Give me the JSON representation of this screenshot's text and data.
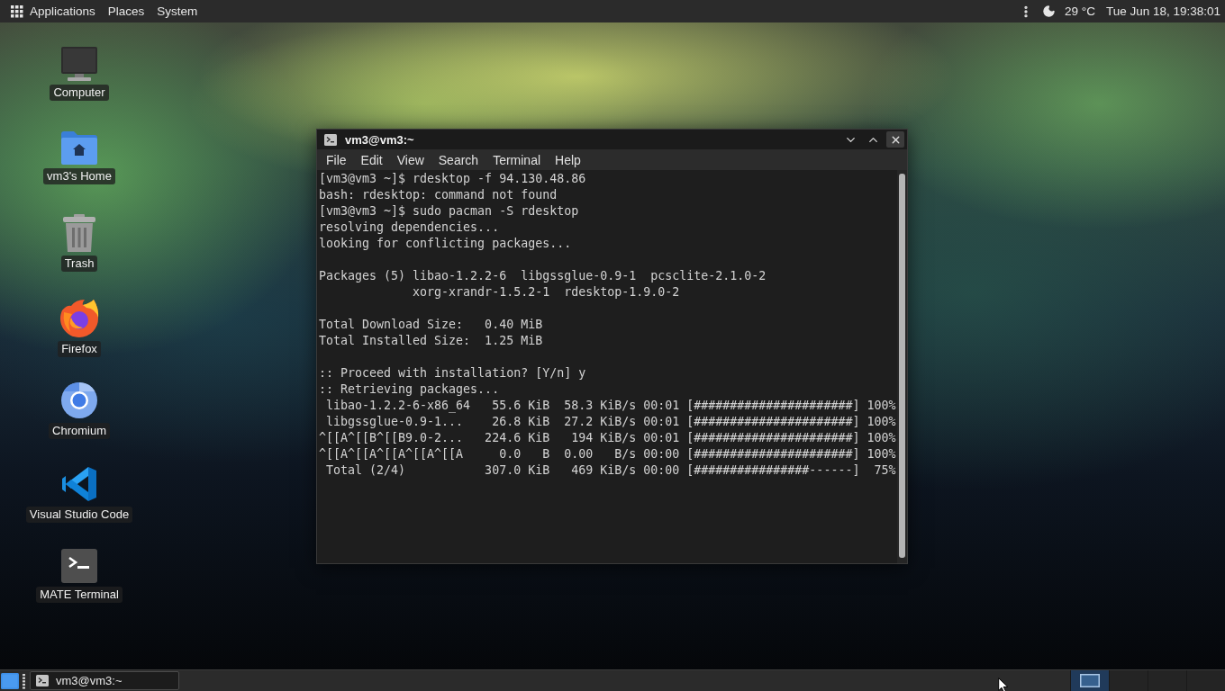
{
  "top_panel": {
    "menus": [
      {
        "label": "Applications"
      },
      {
        "label": "Places"
      },
      {
        "label": "System"
      }
    ],
    "temperature": "29 °C",
    "clock": "Tue Jun 18, 19:38:01"
  },
  "desktop_icons": [
    {
      "label": "Computer",
      "kind": "computer"
    },
    {
      "label": "vm3's Home",
      "kind": "home"
    },
    {
      "label": "Trash",
      "kind": "trash"
    },
    {
      "label": "Firefox",
      "kind": "firefox"
    },
    {
      "label": "Chromium",
      "kind": "chromium"
    },
    {
      "label": "Visual Studio Code",
      "kind": "vscode"
    },
    {
      "label": "MATE Terminal",
      "kind": "terminal"
    }
  ],
  "terminal_window": {
    "title": "vm3@vm3:~",
    "menu": [
      "File",
      "Edit",
      "View",
      "Search",
      "Terminal",
      "Help"
    ],
    "blocks": [
      [
        "[vm3@vm3 ~]$ rdesktop -f 94.130.48.86",
        "bash: rdesktop: command not found",
        "[vm3@vm3 ~]$ sudo pacman -S rdesktop",
        "resolving dependencies...",
        "looking for conflicting packages..."
      ],
      [
        "Packages (5) libao-1.2.2-6  libgssglue-0.9-1  pcsclite-2.1.0-2",
        "             xorg-xrandr-1.5.2-1  rdesktop-1.9.0-2"
      ],
      [
        "Total Download Size:   0.40 MiB",
        "Total Installed Size:  1.25 MiB"
      ],
      [
        ":: Proceed with installation? [Y/n] y",
        ":: Retrieving packages...",
        " libao-1.2.2-6-x86_64   55.6 KiB  58.3 KiB/s 00:01 [######################] 100%",
        " libgssglue-0.9-1...    26.8 KiB  27.2 KiB/s 00:01 [######################] 100%",
        "^[[A^[[B^[[B9.0-2...   224.6 KiB   194 KiB/s 00:01 [######################] 100%",
        "^[[A^[[A^[[A^[[A^[[A     0.0   B  0.00   B/s 00:00 [######################] 100%",
        " Total (2/4)           307.0 KiB   469 KiB/s 00:00 [################------]  75%"
      ]
    ]
  },
  "bottom_panel": {
    "tasks": [
      {
        "label": "vm3@vm3:~",
        "selected": true
      }
    ],
    "workspaces": [
      {
        "selected": true,
        "has_window": true
      },
      {
        "selected": false,
        "has_window": false
      },
      {
        "selected": false,
        "has_window": false
      },
      {
        "selected": false,
        "has_window": false
      }
    ]
  }
}
